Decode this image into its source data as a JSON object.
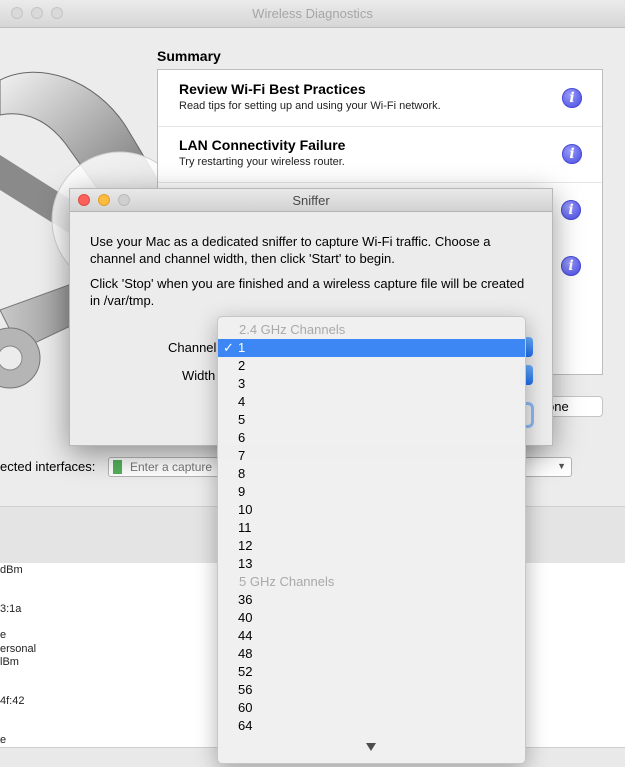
{
  "diagnostics_window": {
    "title": "Wireless Diagnostics",
    "summary_label": "Summary",
    "summary_items": [
      {
        "title": "Review Wi-Fi Best Practices",
        "description": "Read tips for setting up and using your Wi-Fi network."
      },
      {
        "title": "LAN Connectivity Failure",
        "description": "Try restarting your wireless router."
      }
    ],
    "info_icon_glyph": "i",
    "done_button_partial": "one",
    "interfaces_label": "ected interfaces:",
    "capture_placeholder": "Enter a capture",
    "info_fragments": [
      "dBm",
      "3:1a",
      "e",
      "ersonal",
      "lBm",
      "4f:42",
      "e"
    ]
  },
  "sniffer_dialog": {
    "title": "Sniffer",
    "instruction_1": "Use your Mac as a dedicated sniffer to capture Wi-Fi traffic.  Choose a channel and channel width, then click 'Start' to begin.",
    "instruction_2": "Click 'Stop' when you are finished and a wireless capture file will be created in /var/tmp.",
    "channel_label": "Channel",
    "width_label": "Width"
  },
  "channel_menu": {
    "header_24": "2.4 GHz Channels",
    "checkmark": "✓",
    "selected": "1",
    "channels_24": [
      "1",
      "2",
      "3",
      "4",
      "5",
      "6",
      "7",
      "8",
      "9",
      "10",
      "11",
      "12",
      "13"
    ],
    "header_5": "5 GHz Channels",
    "channels_5": [
      "36",
      "40",
      "44",
      "48",
      "52",
      "56",
      "60",
      "64"
    ]
  },
  "colors": {
    "selection": "#3d87f5",
    "info_icon": "#5a5de8",
    "close": "#fc605b",
    "minimize": "#fdbc40"
  }
}
